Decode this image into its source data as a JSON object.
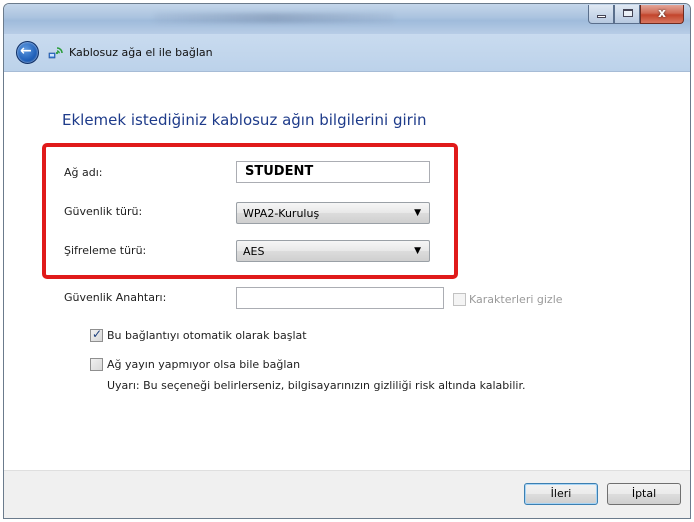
{
  "window": {
    "nav_title": "Kablosuz ağa el ile bağlan",
    "caption": {
      "minimize_glyph": "",
      "maximize_glyph": "",
      "close_glyph": "x"
    },
    "icons": {
      "back": "back-arrow-icon",
      "network": "wireless-network-icon"
    }
  },
  "page": {
    "heading": "Eklemek istediğiniz kablosuz ağın bilgilerini girin"
  },
  "form": {
    "network_name": {
      "label": "Ağ adı:",
      "value": "STUDENT"
    },
    "security_type": {
      "label": "Güvenlik türü:",
      "value": "WPA2-Kuruluş"
    },
    "encryption_type": {
      "label": "Şifreleme türü:",
      "value": "AES"
    },
    "security_key": {
      "label": "Güvenlik Anahtarı:",
      "value": ""
    },
    "hide_characters": {
      "label": "Karakterleri gizle",
      "checked": false,
      "enabled": false
    },
    "auto_start": {
      "label": "Bu bağlantıyı otomatik olarak başlat",
      "checked": true
    },
    "connect_hidden": {
      "label": "Ağ yayın yapmıyor olsa bile bağlan",
      "checked": false
    },
    "warning": "Uyarı: Bu seçeneği belirlerseniz, bilgisayarınızın gizliliği risk altında kalabilir."
  },
  "footer": {
    "next_label": "İleri",
    "cancel_label": "İptal"
  },
  "colors": {
    "highlight_frame": "#e01a1a",
    "heading": "#1e3b8a"
  }
}
